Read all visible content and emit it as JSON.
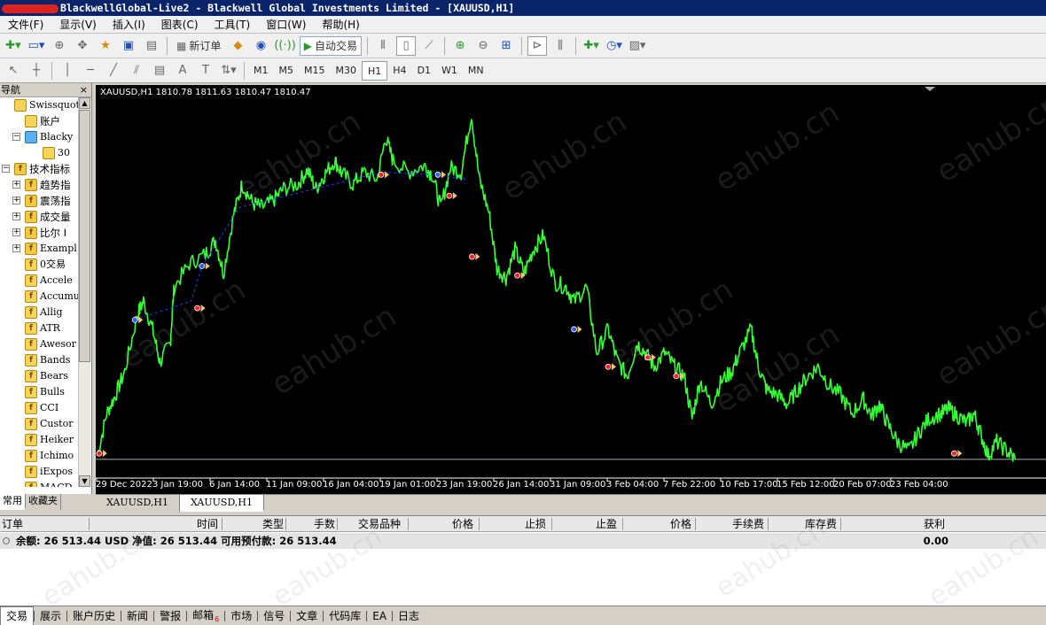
{
  "window": {
    "title": "BlackwellGlobal-Live2 - Blackwell Global Investments Limited - [XAUUSD,H1]"
  },
  "menu": [
    "文件(F)",
    "显示(V)",
    "插入(I)",
    "图表(C)",
    "工具(T)",
    "窗口(W)",
    "帮助(H)"
  ],
  "toolbar": {
    "new_order": "新订单",
    "auto_trading": "自动交易"
  },
  "timeframes": [
    "M1",
    "M5",
    "M15",
    "M30",
    "H1",
    "H4",
    "D1",
    "W1",
    "MN"
  ],
  "active_timeframe": "H1",
  "draw_tools": {
    "text": "A",
    "label": "T"
  },
  "navigator": {
    "title": "导航",
    "close": "×",
    "tree": [
      {
        "label": "Swissquote B",
        "level": 0,
        "expander": "",
        "icon": "globe"
      },
      {
        "label": "账户",
        "level": 1,
        "expander": "",
        "icon": "accounts"
      },
      {
        "label": "Blacky",
        "level": 1,
        "expander": "⊟",
        "icon": "server"
      },
      {
        "label": "30",
        "level": 2,
        "expander": "",
        "icon": "account"
      },
      {
        "label": "技术指标",
        "level": 0,
        "expander": "⊟",
        "icon": "folder"
      },
      {
        "label": "趋势指",
        "level": 1,
        "expander": "⊞",
        "icon": "folder"
      },
      {
        "label": "震荡指",
        "level": 1,
        "expander": "⊞",
        "icon": "folder"
      },
      {
        "label": "成交量",
        "level": 1,
        "expander": "⊞",
        "icon": "folder"
      },
      {
        "label": "比尔 I",
        "level": 1,
        "expander": "⊞",
        "icon": "folder"
      },
      {
        "label": "Exampl",
        "level": 1,
        "expander": "⊞",
        "icon": "folder"
      },
      {
        "label": "0交易",
        "level": 1,
        "expander": "",
        "icon": "indicator"
      },
      {
        "label": "Accele",
        "level": 1,
        "expander": "",
        "icon": "indicator"
      },
      {
        "label": "Accumu",
        "level": 1,
        "expander": "",
        "icon": "indicator"
      },
      {
        "label": "Allig",
        "level": 1,
        "expander": "",
        "icon": "indicator"
      },
      {
        "label": "ATR",
        "level": 1,
        "expander": "",
        "icon": "indicator"
      },
      {
        "label": "Awesor",
        "level": 1,
        "expander": "",
        "icon": "indicator"
      },
      {
        "label": "Bands",
        "level": 1,
        "expander": "",
        "icon": "indicator"
      },
      {
        "label": "Bears",
        "level": 1,
        "expander": "",
        "icon": "indicator"
      },
      {
        "label": "Bulls",
        "level": 1,
        "expander": "",
        "icon": "indicator"
      },
      {
        "label": "CCI",
        "level": 1,
        "expander": "",
        "icon": "indicator"
      },
      {
        "label": "Custor",
        "level": 1,
        "expander": "",
        "icon": "indicator"
      },
      {
        "label": "Heiker",
        "level": 1,
        "expander": "",
        "icon": "indicator"
      },
      {
        "label": "Ichimo",
        "level": 1,
        "expander": "",
        "icon": "indicator"
      },
      {
        "label": "iExpos",
        "level": 1,
        "expander": "",
        "icon": "indicator"
      },
      {
        "label": "MACD",
        "level": 1,
        "expander": "",
        "icon": "indicator"
      }
    ],
    "tabs": [
      "常用",
      "收藏夹"
    ],
    "active_tab": "常用"
  },
  "chart": {
    "info": "XAUUSD,H1  1810.78 1811.63 1810.47 1810.47",
    "tabs": [
      "XAUUSD,H1",
      "XAUUSD,H1"
    ],
    "active_tab_index": 1,
    "watermark": "eahub.cn"
  },
  "chart_data": {
    "type": "line",
    "symbol": "XAUUSD",
    "timeframe": "H1",
    "x_tick_labels": [
      "29 Dec 2022",
      "3 Jan 19:00",
      "6 Jan 14:00",
      "11 Jan 09:00",
      "16 Jan 04:00",
      "19 Jan 01:00",
      "23 Jan 19:00",
      "26 Jan 14:00",
      "31 Jan 09:00",
      "3 Feb 04:00",
      "7 Feb 22:00",
      "10 Feb 17:00",
      "15 Feb 12:00",
      "20 Feb 07:00",
      "23 Feb 04:00"
    ],
    "series": [
      {
        "color": "#33ff33",
        "anchors": [
          [
            0,
            1812
          ],
          [
            0.016,
            1830
          ],
          [
            0.032,
            1838
          ],
          [
            0.048,
            1848
          ],
          [
            0.07,
            1872
          ],
          [
            0.081,
            1878
          ],
          [
            0.097,
            1866
          ],
          [
            0.11,
            1852
          ],
          [
            0.128,
            1860
          ],
          [
            0.135,
            1884
          ],
          [
            0.162,
            1894
          ],
          [
            0.19,
            1898
          ],
          [
            0.208,
            1904
          ],
          [
            0.222,
            1890
          ],
          [
            0.24,
            1915
          ],
          [
            0.255,
            1928
          ],
          [
            0.273,
            1920
          ],
          [
            0.29,
            1918
          ],
          [
            0.31,
            1921
          ],
          [
            0.328,
            1926
          ],
          [
            0.353,
            1928
          ],
          [
            0.37,
            1934
          ],
          [
            0.385,
            1926
          ],
          [
            0.4,
            1932
          ],
          [
            0.418,
            1938
          ],
          [
            0.43,
            1933
          ],
          [
            0.45,
            1928
          ],
          [
            0.47,
            1933
          ],
          [
            0.493,
            1930
          ],
          [
            0.508,
            1948
          ],
          [
            0.521,
            1938
          ],
          [
            0.548,
            1933
          ],
          [
            0.576,
            1936
          ],
          [
            0.59,
            1932
          ],
          [
            0.605,
            1918
          ],
          [
            0.622,
            1935
          ],
          [
            0.641,
            1933
          ],
          [
            0.659,
            1958
          ],
          [
            0.673,
            1930
          ],
          [
            0.69,
            1916
          ],
          [
            0.704,
            1892
          ],
          [
            0.72,
            1888
          ],
          [
            0.736,
            1900
          ],
          [
            0.752,
            1890
          ],
          [
            0.768,
            1900
          ],
          [
            0.786,
            1906
          ],
          [
            0.806,
            1886
          ],
          [
            0.826,
            1884
          ],
          [
            0.84,
            1878
          ],
          [
            0.862,
            1884
          ],
          [
            0.88,
            1856
          ],
          [
            0.9,
            1866
          ],
          [
            0.917,
            1852
          ],
          [
            0.934,
            1846
          ],
          [
            0.951,
            1860
          ],
          [
            0.966,
            1856
          ],
          [
            0.981,
            1850
          ],
          [
            1.0,
            1856
          ],
          [
            1.017,
            1850
          ],
          [
            1.034,
            1846
          ],
          [
            1.048,
            1828
          ],
          [
            1.062,
            1844
          ],
          [
            1.082,
            1834
          ],
          [
            1.1,
            1844
          ],
          [
            1.118,
            1848
          ],
          [
            1.132,
            1856
          ],
          [
            1.152,
            1866
          ],
          [
            1.165,
            1850
          ],
          [
            1.18,
            1840
          ],
          [
            1.199,
            1838
          ],
          [
            1.216,
            1834
          ],
          [
            1.233,
            1840
          ],
          [
            1.252,
            1846
          ],
          [
            1.27,
            1850
          ],
          [
            1.29,
            1842
          ],
          [
            1.31,
            1838
          ],
          [
            1.33,
            1830
          ],
          [
            1.35,
            1836
          ],
          [
            1.365,
            1829
          ],
          [
            1.378,
            1834
          ],
          [
            1.392,
            1826
          ],
          [
            1.41,
            1818
          ],
          [
            1.43,
            1814
          ],
          [
            1.448,
            1822
          ],
          [
            1.466,
            1828
          ],
          [
            1.487,
            1830
          ],
          [
            1.5,
            1832
          ],
          [
            1.516,
            1829
          ],
          [
            1.532,
            1826
          ],
          [
            1.545,
            1830
          ],
          [
            1.556,
            1822
          ],
          [
            1.57,
            1812
          ],
          [
            1.585,
            1818
          ],
          [
            1.603,
            1814
          ],
          [
            1.618,
            1810.47
          ]
        ]
      }
    ],
    "overlay_line": {
      "color": "#1f3fff",
      "style": "dashed",
      "points": [
        [
          0.066,
          1870
        ],
        [
          0.165,
          1878
        ],
        [
          0.184,
          1893
        ],
        [
          0.25,
          1918
        ],
        [
          0.5,
          1933
        ],
        [
          0.6,
          1932
        ],
        [
          0.65,
          1930
        ]
      ]
    },
    "markers": [
      {
        "x": 0.003,
        "y": 1813,
        "kind": "sell"
      },
      {
        "x": 0.066,
        "y": 1870,
        "kind": "buy"
      },
      {
        "x": 0.184,
        "y": 1893,
        "kind": "buy"
      },
      {
        "x": 0.176,
        "y": 1875,
        "kind": "sell"
      },
      {
        "x": 0.5,
        "y": 1932,
        "kind": "sell"
      },
      {
        "x": 0.6,
        "y": 1932,
        "kind": "buy"
      },
      {
        "x": 0.62,
        "y": 1923,
        "kind": "sell"
      },
      {
        "x": 0.66,
        "y": 1897,
        "kind": "sell"
      },
      {
        "x": 0.74,
        "y": 1889,
        "kind": "sell"
      },
      {
        "x": 0.84,
        "y": 1866,
        "kind": "buy"
      },
      {
        "x": 0.9,
        "y": 1850,
        "kind": "sell"
      },
      {
        "x": 0.97,
        "y": 1854,
        "kind": "sell"
      },
      {
        "x": 1.02,
        "y": 1846,
        "kind": "sell"
      },
      {
        "x": 1.51,
        "y": 1813,
        "kind": "sell"
      }
    ],
    "ylim": [
      1804,
      1965
    ],
    "grid": false,
    "background": "#000000",
    "current_price": 1810.47
  },
  "terminal": {
    "columns": [
      "订单",
      "时间",
      "类型",
      "手数",
      "交易品种",
      "价格",
      "止损",
      "止盈",
      "价格",
      "手续费",
      "库存费",
      "获利"
    ],
    "balance_text": "余额: 26 513.44 USD  净值: 26 513.44  可用预付款: 26 513.44",
    "profit_total": "0.00"
  },
  "bottom_tabs": [
    {
      "label": "交易",
      "active": true
    },
    {
      "label": "展示"
    },
    {
      "label": "账户历史"
    },
    {
      "label": "新闻"
    },
    {
      "label": "警报"
    },
    {
      "label": "邮箱",
      "badge": "6"
    },
    {
      "label": "市场"
    },
    {
      "label": "信号"
    },
    {
      "label": "文章"
    },
    {
      "label": "代码库"
    },
    {
      "label": "EA"
    },
    {
      "label": "日志"
    }
  ]
}
